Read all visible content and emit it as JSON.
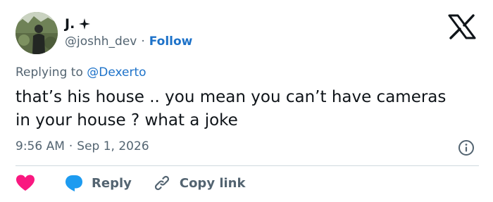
{
  "author": {
    "display_name": "J.",
    "handle": "@joshh_dev",
    "separator": "·",
    "follow_label": "Follow"
  },
  "reply_context": {
    "prefix": "Replying to",
    "mention": "@Dexerto"
  },
  "tweet": {
    "text": "that’s his house .. you mean you can’t have cameras in your house ? what a joke",
    "time": "9:56 AM",
    "separator": "·",
    "date": "Sep 1, 2026"
  },
  "actions": {
    "reply_label": "Reply",
    "copy_link_label": "Copy link"
  },
  "colors": {
    "link_blue": "#1d72c9",
    "heart_red": "#f91880",
    "reply_blue": "#1d9bf0",
    "muted_gray": "#536471",
    "text_dark": "#0f1419"
  },
  "icons": [
    "sparkle-badge-icon",
    "x-logo-icon",
    "info-icon",
    "heart-icon",
    "reply-bubble-icon",
    "link-icon"
  ]
}
